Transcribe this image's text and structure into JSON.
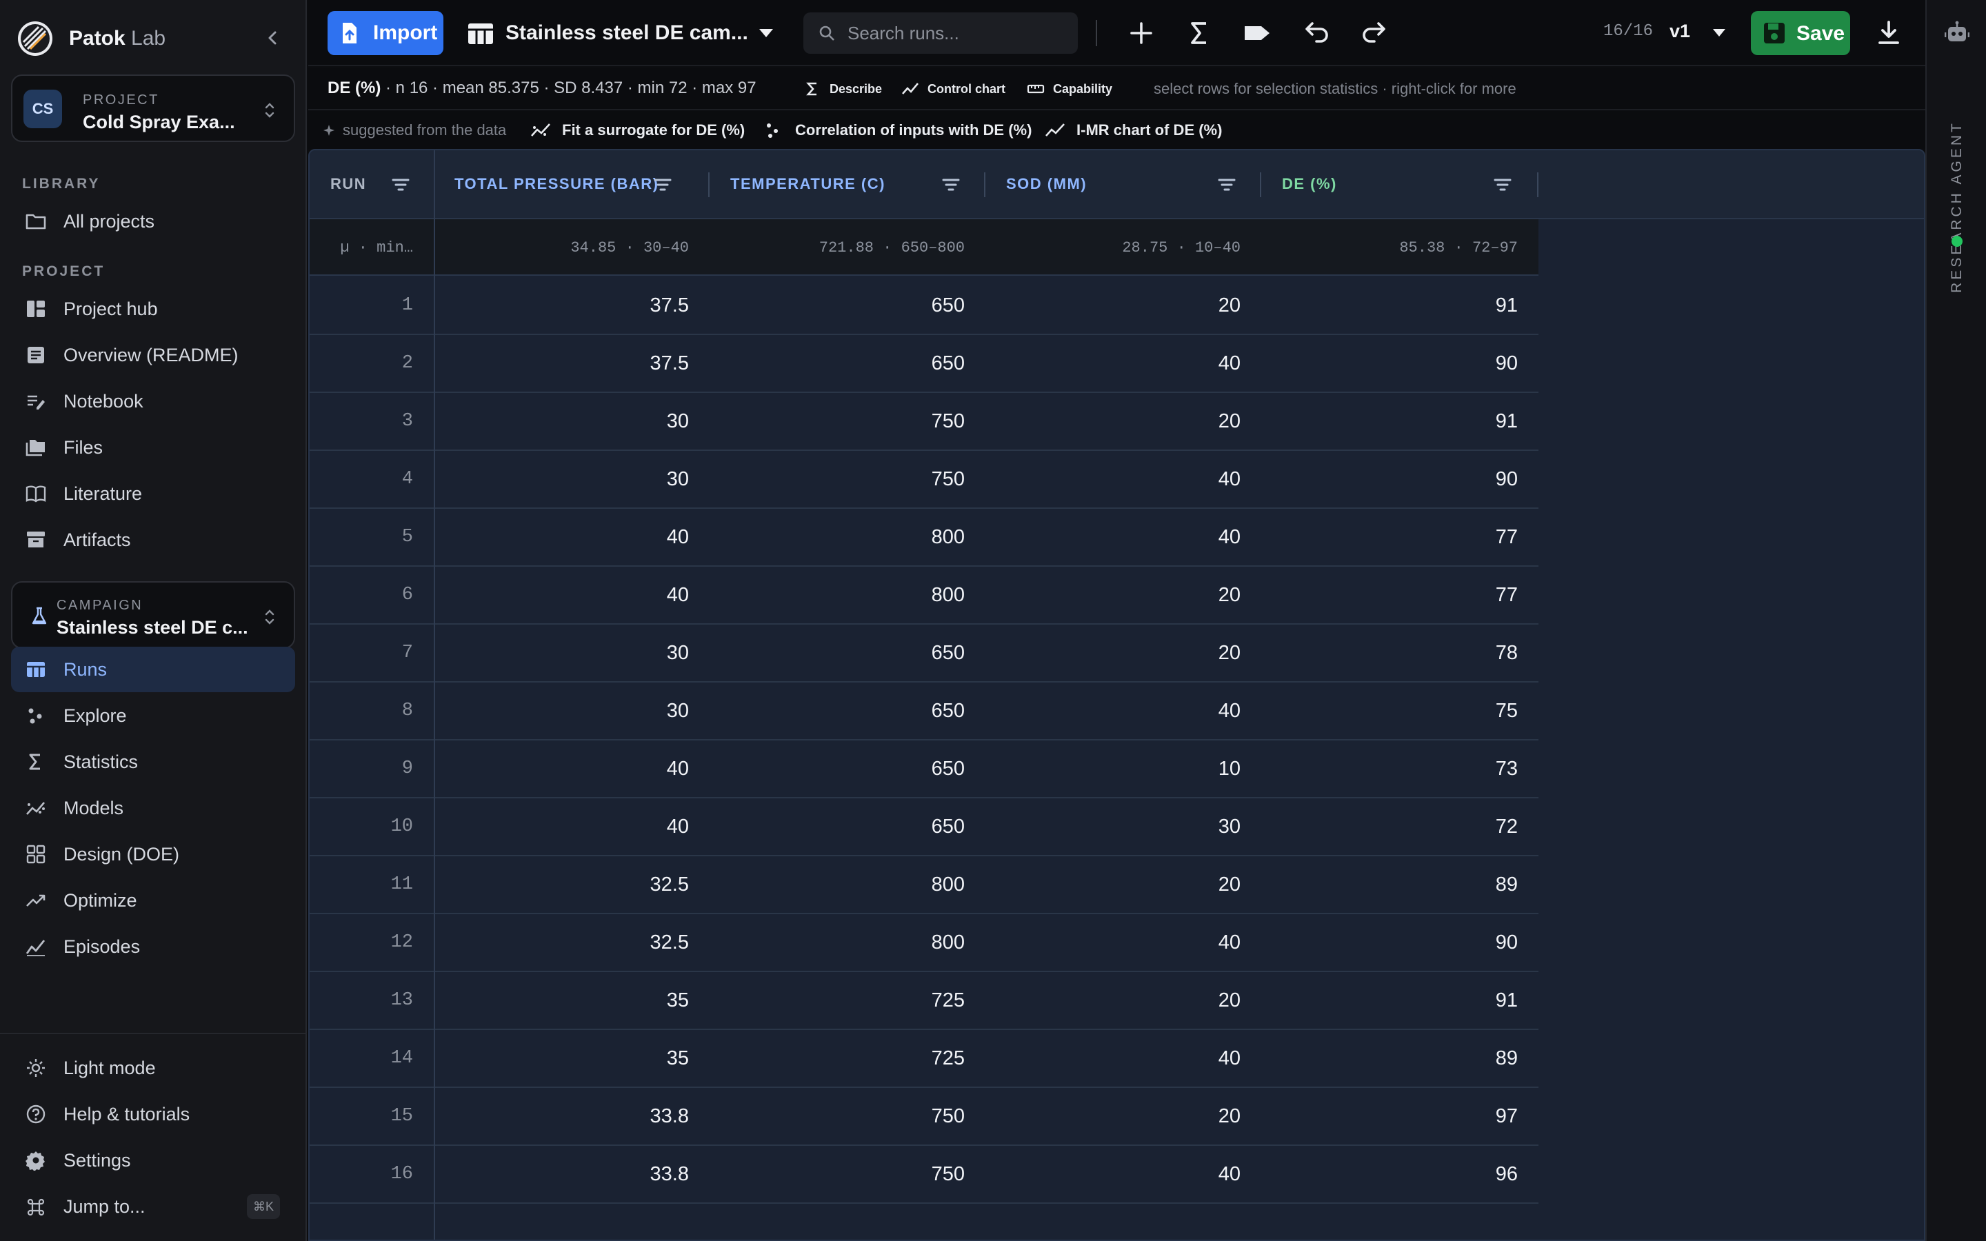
{
  "app": {
    "name_bold": "Patok",
    "name_light": "Lab"
  },
  "project_switcher": {
    "initials": "CS",
    "kicker": "PROJECT",
    "title": "Cold Spray Exa..."
  },
  "library": {
    "label": "LIBRARY",
    "all_projects": "All projects"
  },
  "project_nav": {
    "label": "PROJECT",
    "items": [
      {
        "label": "Project hub",
        "icon": "hub-icon"
      },
      {
        "label": "Overview (README)",
        "icon": "readme-icon"
      },
      {
        "label": "Notebook",
        "icon": "notebook-icon"
      },
      {
        "label": "Files",
        "icon": "files-icon"
      },
      {
        "label": "Literature",
        "icon": "literature-icon"
      },
      {
        "label": "Artifacts",
        "icon": "archive-icon"
      }
    ]
  },
  "campaign_switcher": {
    "kicker": "CAMPAIGN",
    "title": "Stainless steel DE c..."
  },
  "campaign_nav": {
    "items": [
      {
        "label": "Runs",
        "icon": "table-icon",
        "active": true
      },
      {
        "label": "Explore",
        "icon": "scatter-icon"
      },
      {
        "label": "Statistics",
        "icon": "sigma-icon"
      },
      {
        "label": "Models",
        "icon": "models-icon"
      },
      {
        "label": "Design (DOE)",
        "icon": "grid-icon"
      },
      {
        "label": "Optimize",
        "icon": "trending-icon"
      },
      {
        "label": "Episodes",
        "icon": "episodes-icon"
      }
    ]
  },
  "footer_nav": {
    "light_mode": "Light mode",
    "help": "Help & tutorials",
    "settings": "Settings",
    "jump_to": "Jump to...",
    "jump_kbd": "⌘K"
  },
  "toolbar": {
    "import_label": "Import",
    "dataset_name": "Stainless steel DE cam...",
    "search_placeholder": "Search runs...",
    "counter": "16/16",
    "version": "v1",
    "save_label": "Save",
    "accent": "#2f72f0",
    "save_color": "#1f8a45"
  },
  "stats_strip": {
    "column": "DE (%)",
    "summary": " · n 16 · mean 85.375 · SD 8.437 · min 72 · max 97",
    "describe": "Describe",
    "control_chart": "Control chart",
    "capability": "Capability",
    "hint": "select rows for selection statistics · right-click for more"
  },
  "suggest_strip": {
    "label": "suggested from the data",
    "chips": [
      "Fit a surrogate for DE (%)",
      "Correlation of inputs with DE (%)",
      "I-MR chart of DE (%)"
    ]
  },
  "grid": {
    "columns": [
      {
        "label": "RUN",
        "color": "#aeb6c4"
      },
      {
        "label": "TOTAL PRESSURE (BAR)",
        "color": "#8fb7ff"
      },
      {
        "label": "TEMPERATURE (C)",
        "color": "#8fb7ff"
      },
      {
        "label": "SOD (MM)",
        "color": "#8fb7ff"
      },
      {
        "label": "DE (%)",
        "color": "#7fd9a3"
      }
    ],
    "summary": [
      "µ · min…",
      "34.85 · 30–40",
      "721.88 · 650–800",
      "28.75 · 10–40",
      "85.38 · 72–97"
    ],
    "rows": [
      [
        "1",
        "37.5",
        "650",
        "20",
        "91"
      ],
      [
        "2",
        "37.5",
        "650",
        "40",
        "90"
      ],
      [
        "3",
        "30",
        "750",
        "20",
        "91"
      ],
      [
        "4",
        "30",
        "750",
        "40",
        "90"
      ],
      [
        "5",
        "40",
        "800",
        "40",
        "77"
      ],
      [
        "6",
        "40",
        "800",
        "20",
        "77"
      ],
      [
        "7",
        "30",
        "650",
        "20",
        "78"
      ],
      [
        "8",
        "30",
        "650",
        "40",
        "75"
      ],
      [
        "9",
        "40",
        "650",
        "10",
        "73"
      ],
      [
        "10",
        "40",
        "650",
        "30",
        "72"
      ],
      [
        "11",
        "32.5",
        "800",
        "20",
        "89"
      ],
      [
        "12",
        "32.5",
        "800",
        "40",
        "90"
      ],
      [
        "13",
        "35",
        "725",
        "20",
        "91"
      ],
      [
        "14",
        "35",
        "725",
        "40",
        "89"
      ],
      [
        "15",
        "33.8",
        "750",
        "20",
        "97"
      ],
      [
        "16",
        "33.8",
        "750",
        "40",
        "96"
      ]
    ]
  },
  "agent_rail": {
    "label": "RESEARCH AGENT",
    "status_color": "#22c55e"
  }
}
